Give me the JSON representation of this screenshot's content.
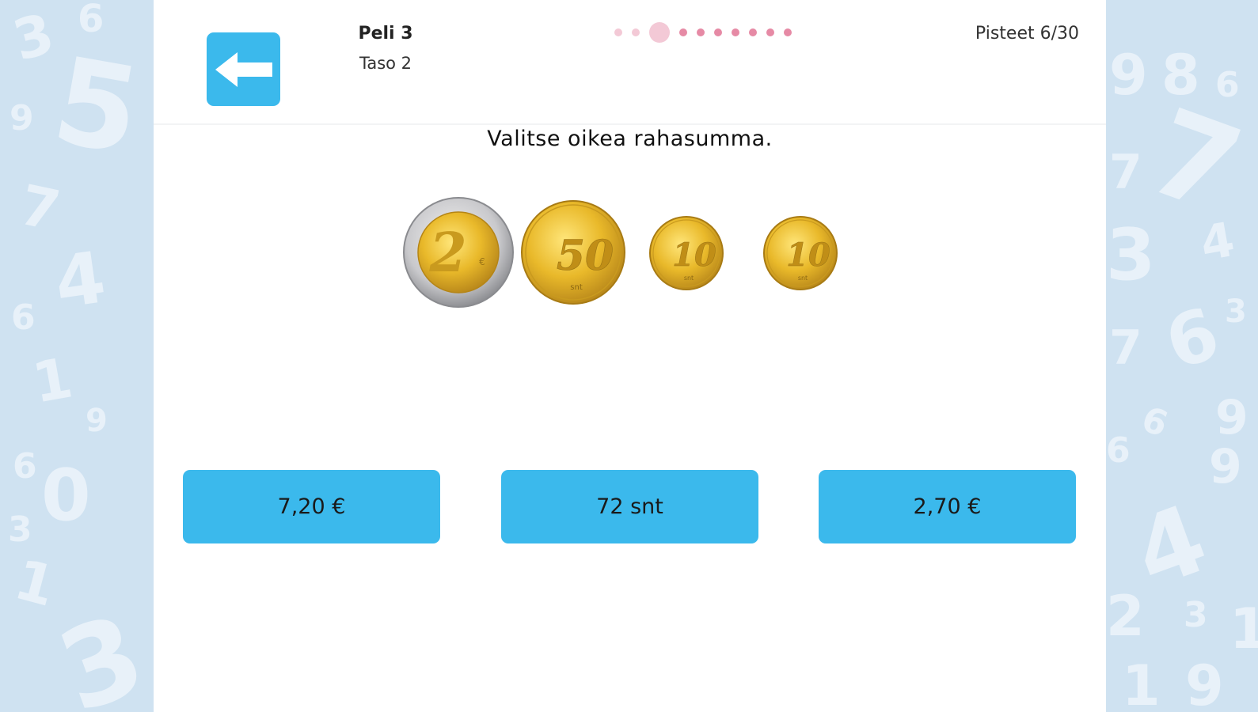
{
  "header": {
    "game": "Peli 3",
    "level": "Taso 2",
    "score": "Pisteet 6/30",
    "progress": {
      "total": 10,
      "current": 3
    }
  },
  "question": {
    "instruction": "Valitse oikea rahasumma."
  },
  "coins": [
    {
      "denomination": "2",
      "unit": "€",
      "material": "bimetal"
    },
    {
      "denomination": "50",
      "unit": "snt",
      "material": "gold"
    },
    {
      "denomination": "10",
      "unit": "snt",
      "material": "gold"
    },
    {
      "denomination": "10",
      "unit": "snt",
      "material": "gold"
    }
  ],
  "answers": [
    {
      "label": "7,20 €"
    },
    {
      "label": "72 snt"
    },
    {
      "label": "2,70 €"
    }
  ],
  "colors": {
    "accent": "#3bb9ec",
    "background": "#cfe2f1",
    "progress_dot": "#e68aa5",
    "progress_done": "#f3c9d6"
  },
  "icons": {
    "back": "arrow-left-icon"
  }
}
